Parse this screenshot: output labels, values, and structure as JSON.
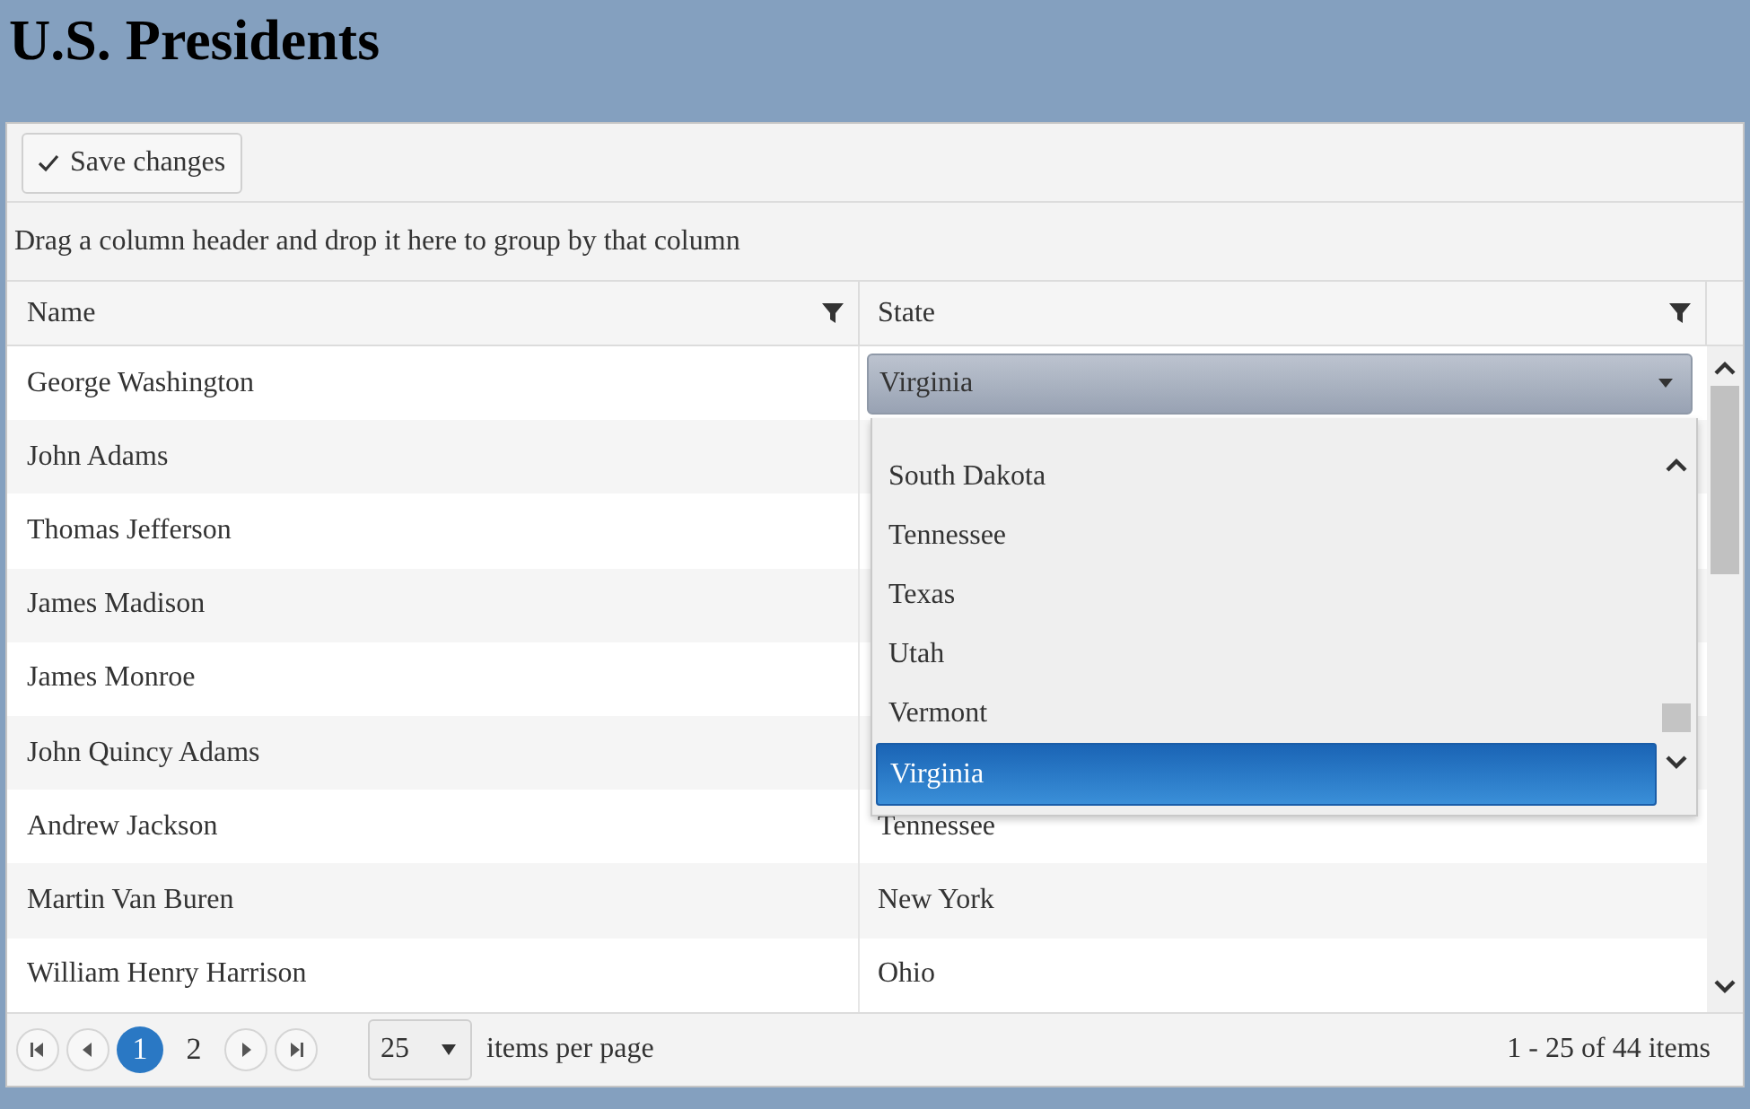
{
  "title": "U.S. Presidents",
  "toolbar": {
    "save_button": "Save changes"
  },
  "group_panel": "Drag a column header and drop it here to group by that column",
  "columns": [
    "Name",
    "State"
  ],
  "rows": [
    {
      "name": "George Washington",
      "editing": true
    },
    {
      "name": "John Adams"
    },
    {
      "name": "Thomas Jefferson"
    },
    {
      "name": "James Madison"
    },
    {
      "name": "James Monroe"
    },
    {
      "name": "John Quincy Adams"
    },
    {
      "name": "Andrew Jackson",
      "state": "Tennessee"
    },
    {
      "name": "Martin Van Buren",
      "state": "New York"
    },
    {
      "name": "William Henry Harrison",
      "state": "Ohio"
    }
  ],
  "editor": {
    "value": "Virginia",
    "options": [
      {
        "label": "South Dakota",
        "selected": false
      },
      {
        "label": "Tennessee",
        "selected": false
      },
      {
        "label": "Texas",
        "selected": false
      },
      {
        "label": "Utah",
        "selected": false
      },
      {
        "label": "Vermont",
        "selected": false
      },
      {
        "label": "Virginia",
        "selected": true
      }
    ]
  },
  "pager": {
    "pages": [
      {
        "label": "1",
        "selected": true
      },
      {
        "label": "2",
        "selected": false
      }
    ],
    "page_size": "25",
    "page_size_label": "items per page",
    "summary": "1 - 25 of 44 items"
  }
}
